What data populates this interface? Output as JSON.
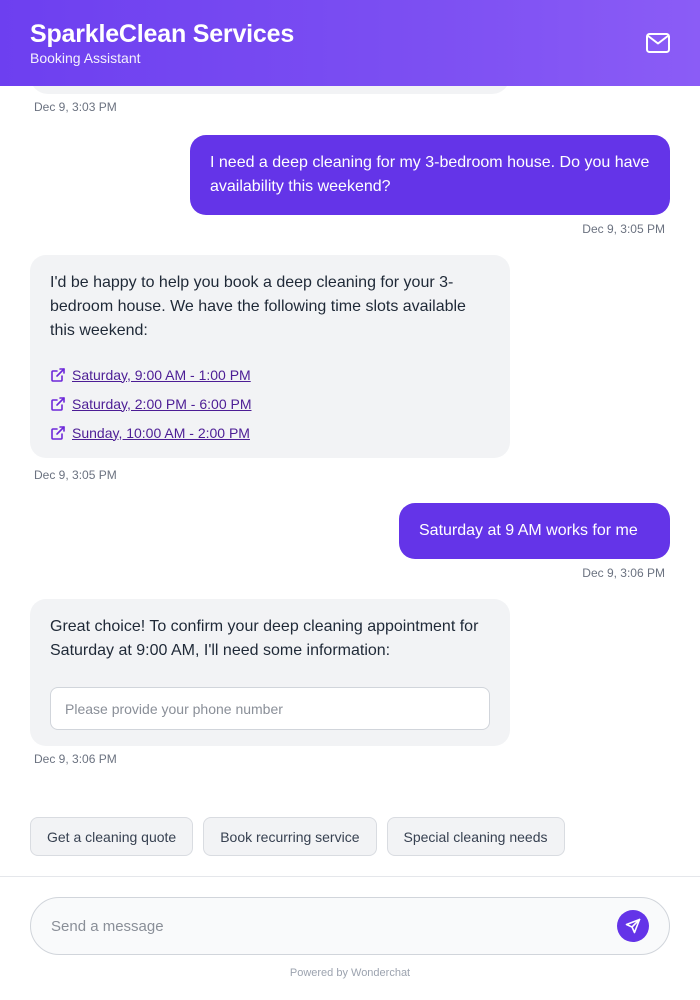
{
  "header": {
    "title": "SparkleClean Services",
    "subtitle": "Booking Assistant",
    "icon": "mail-icon"
  },
  "messages": [
    {
      "sender": "bot",
      "timestamp": "Dec 9, 3:03 PM"
    },
    {
      "sender": "user",
      "text": "I need a deep cleaning for my 3-bedroom house. Do you have availability this weekend?",
      "timestamp": "Dec 9, 3:05 PM"
    },
    {
      "sender": "bot",
      "text": "I'd be happy to help you book a deep cleaning for your 3-bedroom house. We have the following time slots available this weekend:",
      "slots": [
        "Saturday, 9:00 AM - 1:00 PM",
        "Saturday, 2:00 PM - 6:00 PM",
        "Sunday, 10:00 AM - 2:00 PM"
      ],
      "timestamp": "Dec 9, 3:05 PM"
    },
    {
      "sender": "user",
      "text": "Saturday at 9 AM works for me",
      "timestamp": "Dec 9, 3:06 PM"
    },
    {
      "sender": "bot",
      "text": "Great choice! To confirm your deep cleaning appointment for Saturday at 9:00 AM, I'll need some information:",
      "input_placeholder": "Please provide your phone number",
      "input_value": "",
      "timestamp": "Dec 9, 3:06 PM"
    }
  ],
  "quick_replies": [
    "Get a cleaning quote",
    "Book recurring service",
    "Special cleaning needs"
  ],
  "composer": {
    "placeholder": "Send a message",
    "value": "",
    "send_icon": "send-icon"
  },
  "footer": {
    "powered_by": "Powered by Wonderchat"
  },
  "colors": {
    "brand": "#6434e8",
    "header_gradient_start": "#6d3ff0",
    "header_gradient_end": "#8b5cf6",
    "bot_bubble": "#f2f3f5"
  }
}
